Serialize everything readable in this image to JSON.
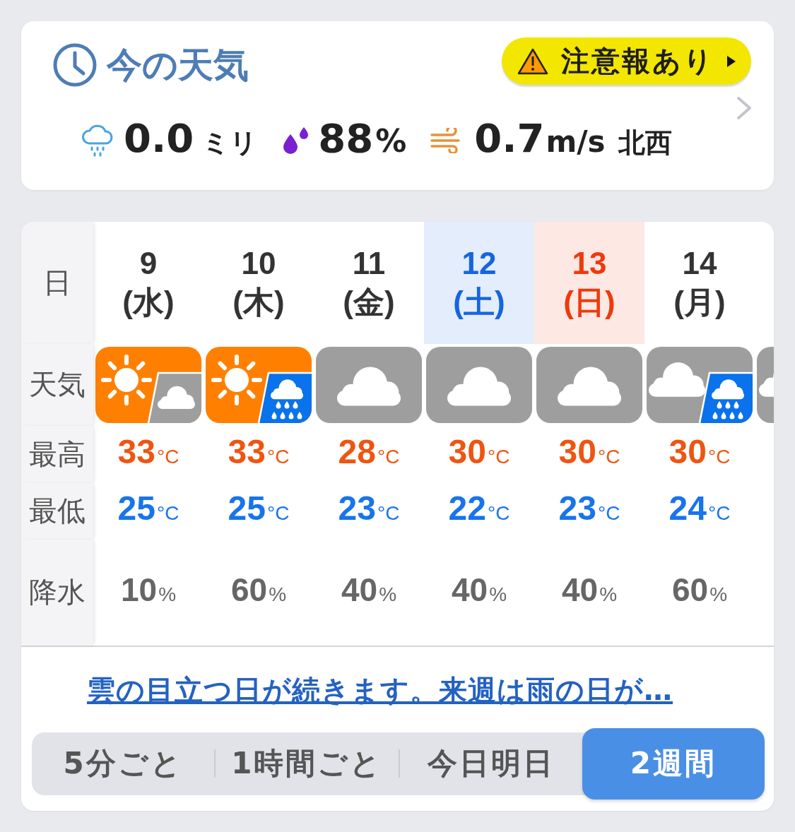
{
  "current": {
    "title": "今の天気",
    "alert": {
      "label": "注意報あり"
    },
    "precipitation": {
      "value": "0.0",
      "unit": "ミリ"
    },
    "humidity": {
      "value": "88",
      "unit": "%"
    },
    "wind": {
      "value": "0.7",
      "unit": "m/s",
      "direction": "北西"
    }
  },
  "forecast": {
    "row_labels": {
      "date": "日",
      "weather": "天気",
      "high": "最高",
      "low": "最低",
      "precipitation": "降水"
    },
    "days": [
      {
        "date": "9",
        "weekday": "(水)",
        "kind": "weekday",
        "weather": [
          {
            "kind": "sun"
          },
          {
            "kind": "cloud"
          }
        ],
        "high": {
          "value": "33",
          "unit": "°C"
        },
        "low": {
          "value": "25",
          "unit": "°C"
        },
        "precipitation": {
          "value": "10",
          "unit": "%"
        }
      },
      {
        "date": "10",
        "weekday": "(木)",
        "kind": "weekday",
        "weather": [
          {
            "kind": "sun"
          },
          {
            "kind": "rain"
          }
        ],
        "high": {
          "value": "33",
          "unit": "°C"
        },
        "low": {
          "value": "25",
          "unit": "°C"
        },
        "precipitation": {
          "value": "60",
          "unit": "%"
        }
      },
      {
        "date": "11",
        "weekday": "(金)",
        "kind": "weekday",
        "weather": [
          {
            "kind": "cloud"
          }
        ],
        "high": {
          "value": "28",
          "unit": "°C"
        },
        "low": {
          "value": "23",
          "unit": "°C"
        },
        "precipitation": {
          "value": "40",
          "unit": "%"
        }
      },
      {
        "date": "12",
        "weekday": "(土)",
        "kind": "saturday",
        "weather": [
          {
            "kind": "cloud"
          }
        ],
        "high": {
          "value": "30",
          "unit": "°C"
        },
        "low": {
          "value": "22",
          "unit": "°C"
        },
        "precipitation": {
          "value": "40",
          "unit": "%"
        }
      },
      {
        "date": "13",
        "weekday": "(日)",
        "kind": "sunday",
        "weather": [
          {
            "kind": "cloud"
          }
        ],
        "high": {
          "value": "30",
          "unit": "°C"
        },
        "low": {
          "value": "23",
          "unit": "°C"
        },
        "precipitation": {
          "value": "40",
          "unit": "%"
        }
      },
      {
        "date": "14",
        "weekday": "(月)",
        "kind": "weekday",
        "weather": [
          {
            "kind": "cloud"
          },
          {
            "kind": "rain"
          }
        ],
        "high": {
          "value": "30",
          "unit": "°C"
        },
        "low": {
          "value": "24",
          "unit": "°C"
        },
        "precipitation": {
          "value": "60",
          "unit": "%"
        }
      }
    ],
    "cut_off_day": {
      "weather": [
        {
          "kind": "cloud"
        }
      ]
    }
  },
  "summary_link": "雲の目立つ日が続きます。来週は雨の日が…",
  "range_tabs": [
    {
      "label": "5分ごと",
      "selected": false
    },
    {
      "label": "1時間ごと",
      "selected": false
    },
    {
      "label": "今日明日",
      "selected": false
    },
    {
      "label": "2週間",
      "selected": true
    }
  ]
}
